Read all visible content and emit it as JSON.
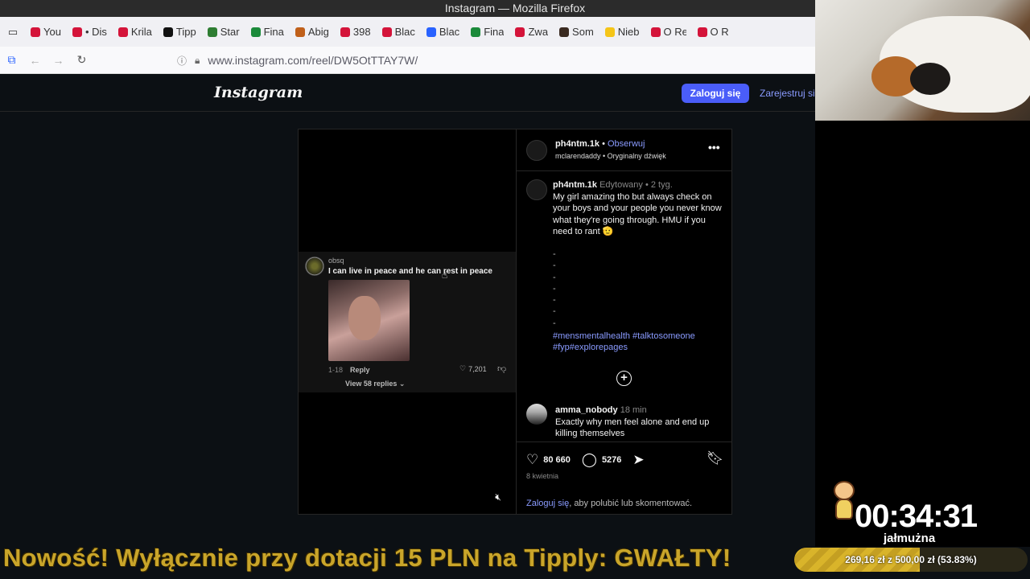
{
  "window": {
    "title": "Instagram — Mozilla Firefox"
  },
  "tabs": [
    {
      "label": "You",
      "color": "#d4143a"
    },
    {
      "label": "• Dis",
      "color": "#d4143a"
    },
    {
      "label": "Krila",
      "color": "#d4143a"
    },
    {
      "label": "Tipp",
      "color": "#111111"
    },
    {
      "label": "Star",
      "color": "#2e7d32"
    },
    {
      "label": "Fina",
      "color": "#1b8a3a"
    },
    {
      "label": "Abig",
      "color": "#c0601a"
    },
    {
      "label": "398",
      "color": "#d4143a"
    },
    {
      "label": "Blac",
      "color": "#d4143a"
    },
    {
      "label": "Blac",
      "color": "#2962ff"
    },
    {
      "label": "Fina",
      "color": "#1b8a3a"
    },
    {
      "label": "Zwa",
      "color": "#d4143a"
    },
    {
      "label": "Som",
      "color": "#3a2a20"
    },
    {
      "label": "Nieb",
      "color": "#f5c518"
    },
    {
      "label": "O Re",
      "color": "#d4143a"
    },
    {
      "label": "O R",
      "color": "#d4143a"
    }
  ],
  "url": "www.instagram.com/reel/DW5OtTTAY7W/",
  "ig": {
    "logo": "Instagram",
    "login_button": "Zaloguj się",
    "register_link": "Zarejestruj się"
  },
  "video_comment": {
    "user": "obsq",
    "text": "I can live in peace and he can rest in peace",
    "meta": "1-18",
    "reply": "Reply",
    "likes": "7,201",
    "view_replies": "View 58 replies"
  },
  "post": {
    "username": "ph4ntm.1k",
    "follow": "Obserwuj",
    "audio": "mclarendaddy • Oryginalny dźwięk",
    "caption_user": "ph4ntm.1k",
    "caption_meta": "Edytowany •  2 tyg.",
    "caption_text": "My girl amazing tho but always check on your boys and your people you never know what they're going through. HMU if you need to rant 🫡",
    "dashes": [
      "-",
      "-",
      "-",
      "-",
      "-",
      "-",
      "-"
    ],
    "hashtags": "#mensmentalhealth #talktosomeone #fyp#explorepages",
    "comment_user": "amma_nobody",
    "comment_time": "18 min",
    "comment_text": "Exactly why men feel alone and end up killing themselves",
    "likes": "80 660",
    "comments": "5276",
    "date": "8 kwietnia",
    "login_link": "Zaloguj się",
    "login_rest": ", aby polubić lub skomentować."
  },
  "stream": {
    "banner": "Nowość! Wyłącznie przy dotacji 15 PLN na Tipply: GWAŁTY!",
    "goal_text": "269,16 zł  z  500,00 zł  (53.83%)",
    "goal_fraction": 0.5383,
    "timer": "00:34:31",
    "timer_label": "jałmużna"
  }
}
